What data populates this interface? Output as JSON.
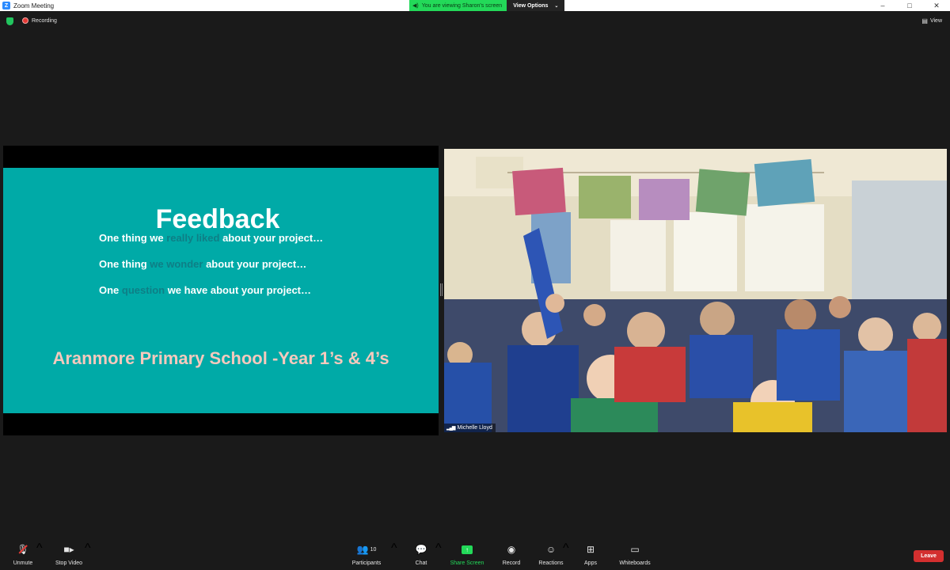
{
  "window": {
    "title": "Zoom Meeting",
    "controls": {
      "minimize": "–",
      "maximize": "□",
      "close": "✕"
    }
  },
  "banner": {
    "viewing_text": "You are viewing Sharon's screen",
    "view_options_label": "View Options",
    "view_options_caret": "⌄"
  },
  "status": {
    "recording_label": "Recording",
    "view_label": "View"
  },
  "slide": {
    "title": "Feedback",
    "line1": {
      "pre": "One thing we ",
      "hl": "really liked",
      "post": " about your project…"
    },
    "line2": {
      "pre": "One thing ",
      "hl": "we wonder",
      "post": " about your project…"
    },
    "line3": {
      "pre": "One ",
      "hl": "question",
      "post": " we have about your project…"
    },
    "school": "Aranmore Primary School -Year 1’s & 4’s",
    "colors": {
      "background": "#00aaa7",
      "highlight": "#0e7f86",
      "school": "#f6c9bd"
    }
  },
  "participant_video": {
    "name": "Michelle Lloyd"
  },
  "toolbar": {
    "unmute": "Unmute",
    "stop_video": "Stop Video",
    "participants": "Participants",
    "participants_count": "10",
    "chat": "Chat",
    "share_screen": "Share Screen",
    "record": "Record",
    "reactions": "Reactions",
    "apps": "Apps",
    "whiteboards": "Whiteboards",
    "leave": "Leave",
    "caret": "^"
  },
  "icons": {
    "zoom_logo": "zoom-logo-icon",
    "mic": "mic-muted-icon",
    "video": "video-camera-icon",
    "participants": "participants-icon",
    "chat": "chat-bubble-icon",
    "share": "share-screen-icon",
    "record": "record-icon",
    "reactions": "reactions-icon",
    "apps": "apps-icon",
    "whiteboards": "whiteboard-icon"
  },
  "colors": {
    "accent_green": "#23d959",
    "leave_red": "#d32f2f",
    "brand_blue": "#2d8cff"
  }
}
